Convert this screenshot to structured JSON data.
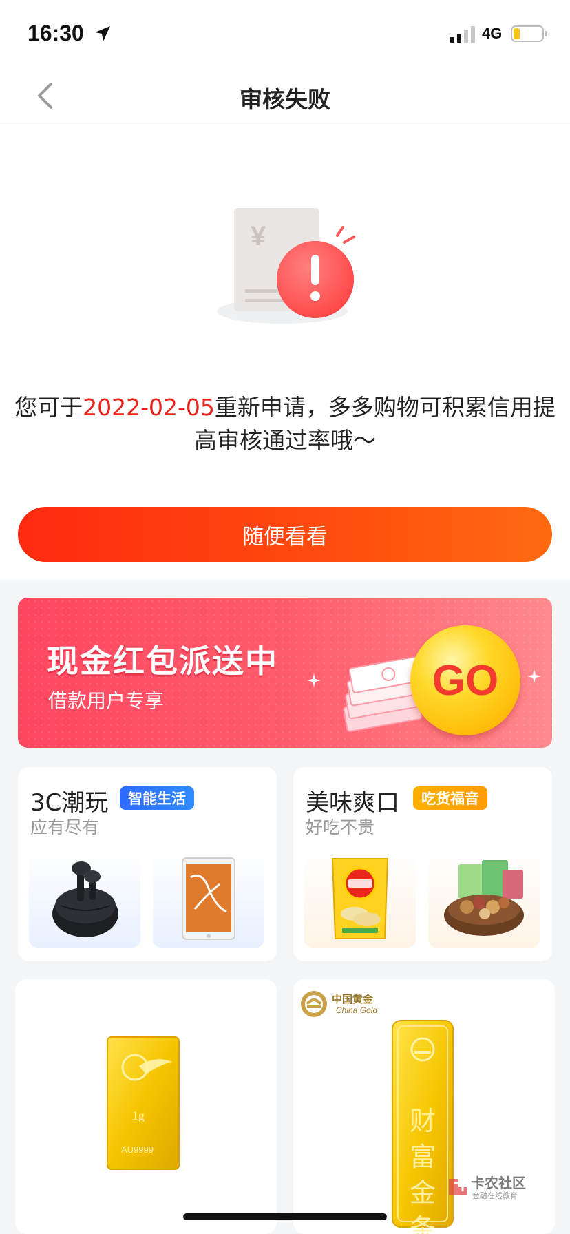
{
  "status_bar": {
    "time": "16:30",
    "network": "4G",
    "battery_level": 0.2
  },
  "nav": {
    "title": "审核失败",
    "back_icon": "chevron-left-icon"
  },
  "result": {
    "illustration_icon": "rejected-document-icon",
    "message_prefix": "您可于",
    "message_date": "2022-02-05",
    "message_suffix": "重新申请，多多购物可积累信用提高审核通过率哦～",
    "button_label": "随便看看",
    "highlight_color": "#e8221c"
  },
  "banner": {
    "title": "现金红包派送中",
    "subtitle": "借款用户专享",
    "go_label": "GO"
  },
  "categories": [
    {
      "title": "3C潮玩",
      "badge": "智能生活",
      "subtitle": "应有尽有",
      "products": [
        "wireless-earbuds",
        "tablet"
      ]
    },
    {
      "title": "美味爽口",
      "badge": "吃货福音",
      "subtitle": "好吃不贵",
      "products": [
        "potato-chips",
        "mixed-nuts"
      ]
    }
  ],
  "gold": [
    {
      "bar_text": "1g",
      "bar_mark": "AU9999"
    },
    {
      "brand_cn": "中国黄金",
      "brand_en": "China Gold",
      "bar_text": "财富金条"
    }
  ],
  "watermark": {
    "title": "卡农社区",
    "subtitle": "金融在线教育"
  }
}
